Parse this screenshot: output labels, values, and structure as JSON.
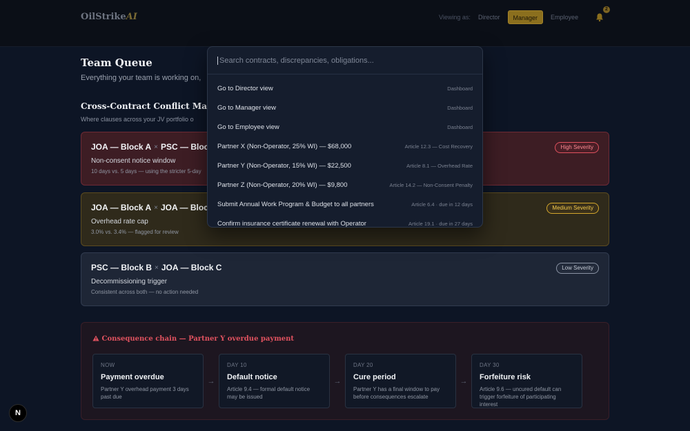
{
  "header": {
    "logo_main": "OilStrike",
    "logo_ai": "AI",
    "viewing_label": "Viewing as:",
    "roles": [
      "Director",
      "Manager",
      "Employee"
    ],
    "active_role": "Manager",
    "notification_count": "2"
  },
  "page": {
    "title": "Team Queue",
    "subtitle": "Everything your team is working on,"
  },
  "conflict_map": {
    "title": "Cross-Contract Conflict Map",
    "subtitle": "Where clauses across your JV portfolio o",
    "items": [
      {
        "a": "JOA — Block A",
        "b": "PSC — Block B",
        "clause": "Non-consent notice window",
        "detail": "10 days vs. 5 days — using the stricter 5-day",
        "severity": "High Severity"
      },
      {
        "a": "JOA — Block A",
        "b": "JOA — Block C",
        "clause": "Overhead rate cap",
        "detail": "3.0% vs. 3.4% — flagged for review",
        "severity": "Medium Severity"
      },
      {
        "a": "PSC — Block B",
        "b": "JOA — Block C",
        "clause": "Decommissioning trigger",
        "detail": "Consistent across both — no action needed",
        "severity": "Low Severity"
      }
    ],
    "times_symbol": "×"
  },
  "chain": {
    "title": "Consequence chain — Partner Y overdue payment",
    "steps": [
      {
        "label": "NOW",
        "title": "Payment overdue",
        "desc": "Partner Y overhead payment 3 days past due"
      },
      {
        "label": "DAY 10",
        "title": "Default notice",
        "desc": "Article 9.4 — formal default notice may be issued"
      },
      {
        "label": "DAY 20",
        "title": "Cure period",
        "desc": "Partner Y has a final window to pay before consequences escalate"
      },
      {
        "label": "DAY 30",
        "title": "Forfeiture risk",
        "desc": "Article 9.6 — uncured default can trigger forfeiture of participating interest"
      }
    ]
  },
  "palette": {
    "placeholder": "Search contracts, discrepancies, obligations...",
    "items": [
      {
        "label": "Go to Director view",
        "meta": "Dashboard"
      },
      {
        "label": "Go to Manager view",
        "meta": "Dashboard"
      },
      {
        "label": "Go to Employee view",
        "meta": "Dashboard"
      },
      {
        "label": "Partner X (Non-Operator, 25% WI) — $68,000",
        "meta": "Article 12.3 — Cost Recovery"
      },
      {
        "label": "Partner Y (Non-Operator, 15% WI) — $22,500",
        "meta": "Article 8.1 — Overhead Rate"
      },
      {
        "label": "Partner Z (Non-Operator, 20% WI) — $9,800",
        "meta": "Article 14.2 — Non-Consent Penalty"
      },
      {
        "label": "Submit Annual Work Program & Budget to all partners",
        "meta": "Article 6.4 · due in 12 days"
      },
      {
        "label": "Confirm insurance certificate renewal with Operator",
        "meta": "Article 19.1 · due in 27 days"
      }
    ]
  },
  "next_badge": "N"
}
